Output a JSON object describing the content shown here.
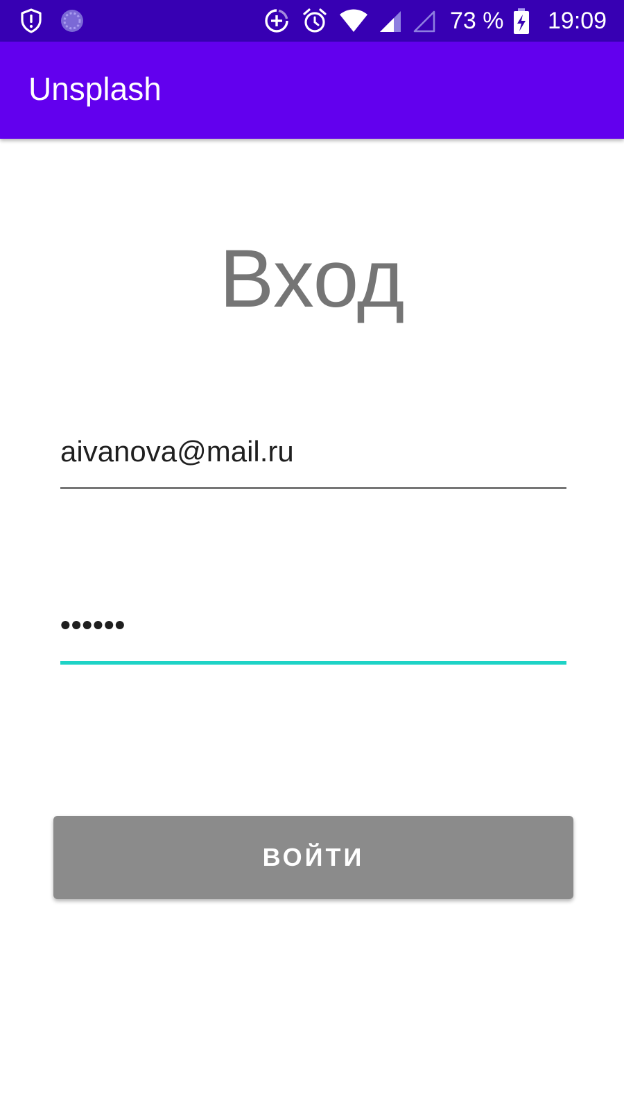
{
  "status_bar": {
    "battery_level": "73 %",
    "clock": "19:09",
    "icons": [
      "shield-alert-icon",
      "loading-circle-icon",
      "data-saver-icon",
      "alarm-icon",
      "wifi-icon",
      "signal-icon",
      "signal-empty-icon",
      "battery-charging-icon"
    ],
    "background_color": "#3700b3"
  },
  "app_bar": {
    "title": "Unsplash",
    "background_color": "#6200ee"
  },
  "login": {
    "heading": "Вход",
    "email_value": "aivanova@mail.ru",
    "password_value": "••••••",
    "button_label": "ВОЙТИ",
    "accent_color": "#1ed3c6",
    "button_color": "#8b8b8b"
  }
}
